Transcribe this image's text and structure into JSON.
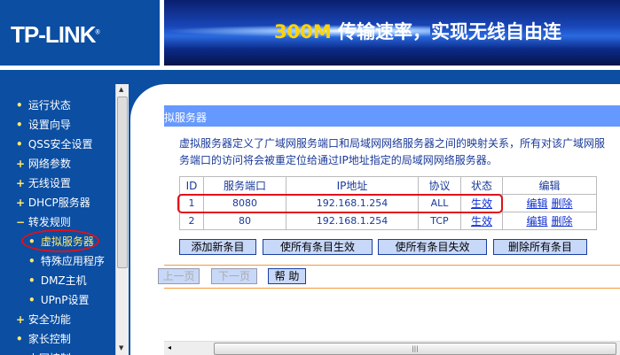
{
  "header": {
    "logo": "TP-LINK",
    "slogan_highlight": "300M",
    "slogan": "传输速率，实现无线自由连"
  },
  "sidebar": {
    "items": [
      {
        "label": "运行状态",
        "bullet": "•"
      },
      {
        "label": "设置向导",
        "bullet": "•"
      },
      {
        "label": "QSS安全设置",
        "bullet": "•"
      },
      {
        "label": "网络参数",
        "bullet": "+"
      },
      {
        "label": "无线设置",
        "bullet": "+"
      },
      {
        "label": "DHCP服务器",
        "bullet": "+"
      },
      {
        "label": "转发规则",
        "bullet": "−"
      },
      {
        "label": "虚拟服务器",
        "bullet": "•",
        "sub": true,
        "active": true
      },
      {
        "label": "特殊应用程序",
        "bullet": "•",
        "sub": true
      },
      {
        "label": "DMZ主机",
        "bullet": "•",
        "sub": true
      },
      {
        "label": "UPnP设置",
        "bullet": "•",
        "sub": true
      },
      {
        "label": "安全功能",
        "bullet": "+"
      },
      {
        "label": "家长控制",
        "bullet": "•"
      },
      {
        "label": "上网控制",
        "bullet": "+"
      }
    ]
  },
  "main": {
    "title": "拟服务器",
    "description": "虚拟服务器定义了广域网服务端口和局域网网络服务器之间的映射关系，所有对该广域网服务端口的访问将会被重定位给通过IP地址指定的局域网网络服务器。",
    "table": {
      "headers": [
        "ID",
        "服务端口",
        "IP地址",
        "协议",
        "状态",
        "编辑"
      ],
      "rows": [
        {
          "id": "1",
          "port": "8080",
          "ip": "192.168.1.254",
          "protocol": "ALL",
          "status": "生效",
          "edit": "编辑",
          "delete": "删除"
        },
        {
          "id": "2",
          "port": "80",
          "ip": "192.168.1.254",
          "protocol": "TCP",
          "status": "生效",
          "edit": "编辑",
          "delete": "删除"
        }
      ]
    },
    "buttons": {
      "add": "添加新条目",
      "enable_all": "使所有条目生效",
      "disable_all": "使所有条目失效",
      "delete_all": "删除所有条目"
    },
    "pager": {
      "prev": "上一页",
      "next": "下一页",
      "help": "帮 助"
    }
  },
  "colors": {
    "brand": "#0b4ea2",
    "titlebar": "#6699ff",
    "highlight": "#e0101a",
    "divider": "#f39a3a"
  }
}
